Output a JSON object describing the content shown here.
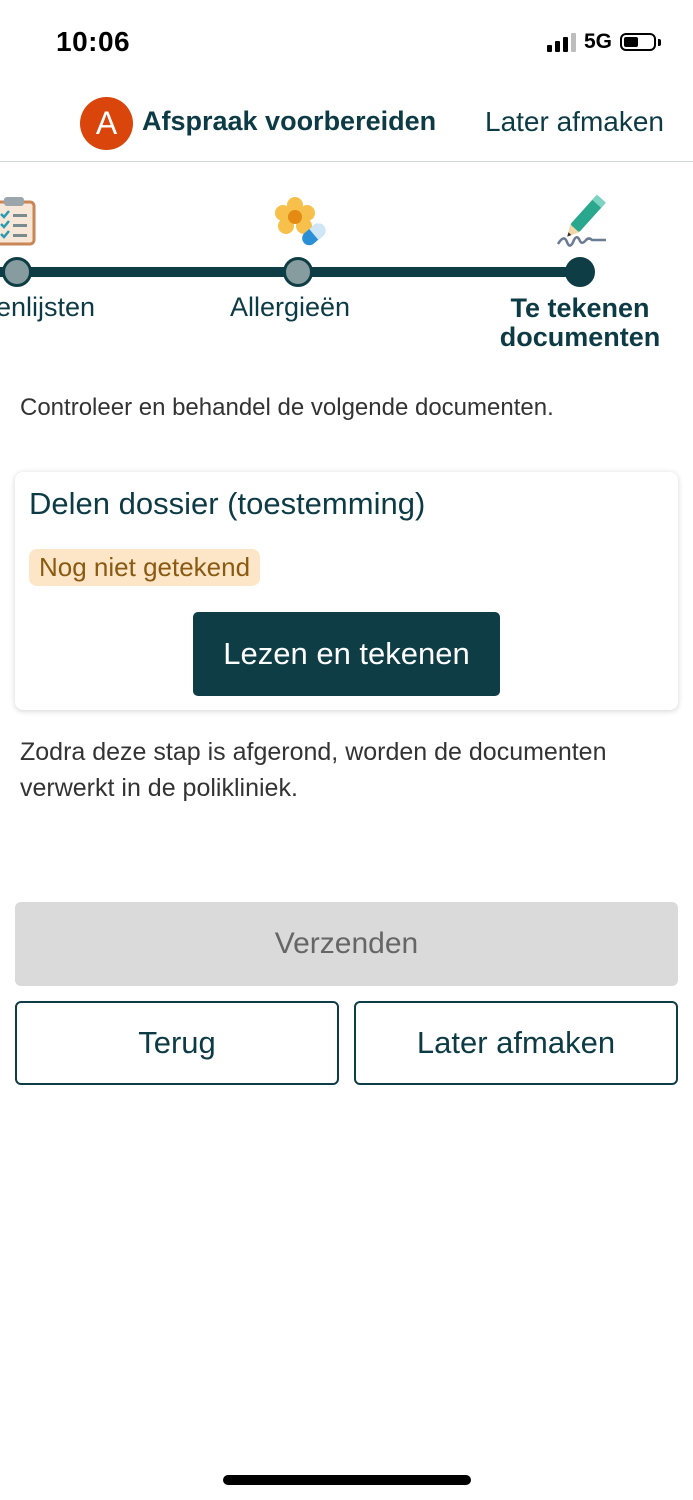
{
  "status_bar": {
    "time": "10:06",
    "network": "5G"
  },
  "header": {
    "avatar_letter": "A",
    "title": "Afspraak voorbereiden",
    "later_link": "Later afmaken"
  },
  "stepper": {
    "steps": [
      {
        "label": "enlijsten",
        "icon": "checklist-clipboard-icon",
        "state": "done"
      },
      {
        "label": "Allergieën",
        "icon": "flower-pill-icon",
        "state": "done"
      },
      {
        "label": "Te tekenen documenten",
        "label_line1": "Te tekenen",
        "label_line2": "documenten",
        "icon": "pen-signature-icon",
        "state": "active"
      }
    ]
  },
  "content": {
    "intro": "Controleer en behandel de volgende documenten.",
    "document_card": {
      "title": "Delen dossier (toestemming)",
      "status_badge": "Nog niet getekend",
      "action_label": "Lezen en tekenen"
    },
    "note": "Zodra deze stap is afgerond, worden de documenten verwerkt in de polikliniek."
  },
  "footer": {
    "send_label": "Verzenden",
    "back_label": "Terug",
    "later_label": "Later afmaken"
  },
  "colors": {
    "primary": "#0e3d46",
    "avatar": "#d9450b",
    "badge_bg": "#fde6c7",
    "badge_text": "#8a5a12",
    "disabled_bg": "#dadada"
  }
}
